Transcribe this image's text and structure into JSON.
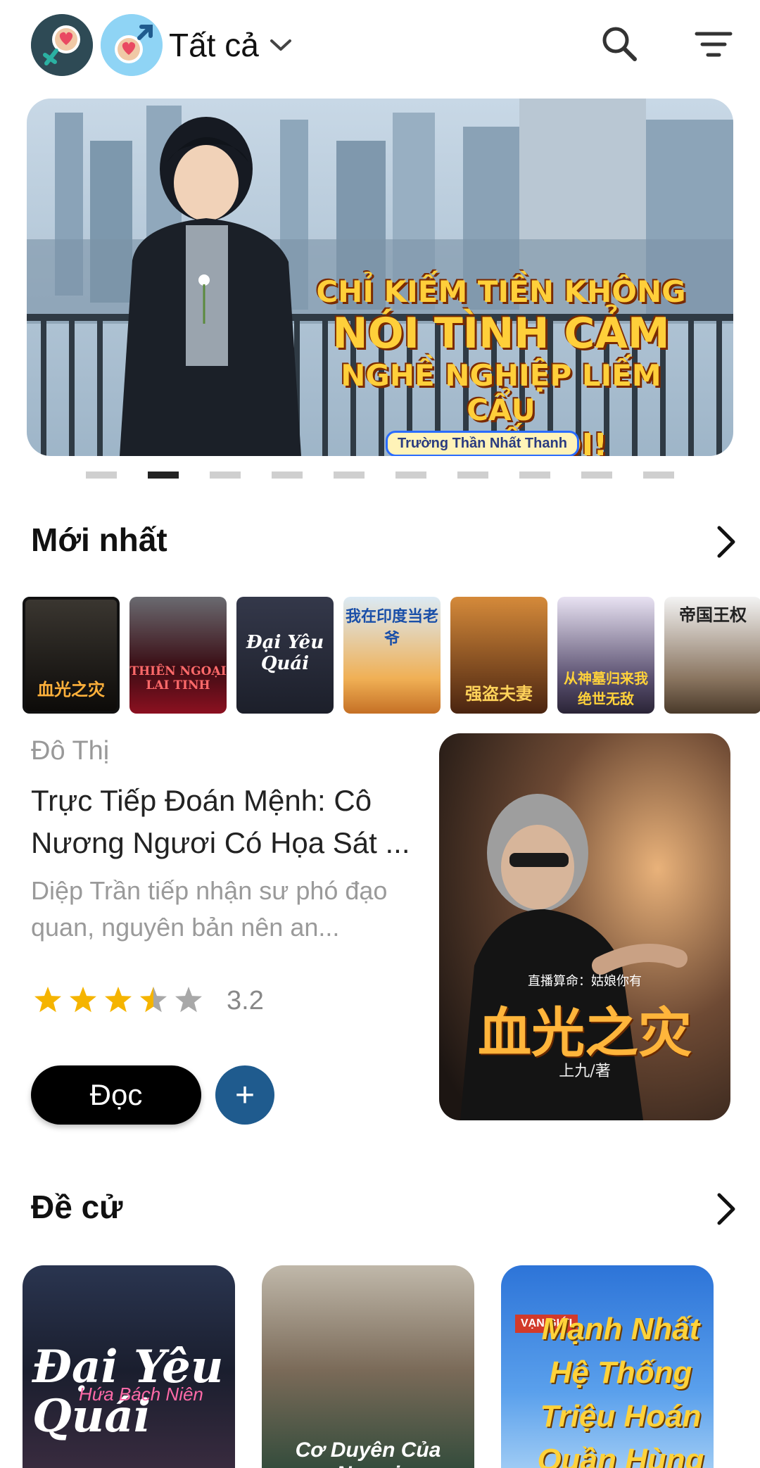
{
  "header": {
    "gender_filter": "Tất cả",
    "icons": [
      "heart-female-icon",
      "heart-male-icon",
      "chevron-down-icon",
      "search-icon",
      "filter-icon"
    ]
  },
  "banner": {
    "title_lines": [
      "CHỈ KIẾM TIỀN KHÔNG",
      "NÓI TÌNH CẢM",
      "NGHỀ NGHIỆP LIẾM CẨU",
      "TA NHẤT ĐI!"
    ],
    "author_tag": "Trường Thần Nhất Thanh",
    "page_count": 10,
    "active_index": 1
  },
  "newest": {
    "title": "Mới nhất",
    "thumbnails": [
      {
        "text": "血光之灾"
      },
      {
        "text": "THIÊN NGOẠI LAI TINH"
      },
      {
        "text": "Đại Yêu Quái"
      },
      {
        "text": "我在印度当老爷"
      },
      {
        "text": "强盗夫妻"
      },
      {
        "text": "从神墓归来我绝世无敌"
      },
      {
        "text": "帝国王权"
      }
    ],
    "featured": {
      "genre": "Đô Thị",
      "title": "Trực Tiếp Đoán Mệnh: Cô Nương Ngươi Có Họa Sát ...",
      "description": "Diệp Trần tiếp nhận sư phó đạo quan, nguyên bản nên an...",
      "rating": "3.2",
      "rating_value": 3.5,
      "read_label": "Đọc",
      "add_label": "+",
      "cover_subtitle": "直播算命：姑娘你有",
      "cover_title": "血光之灾",
      "cover_author": "上九/著"
    }
  },
  "recommended": {
    "title": "Đề cử",
    "items": [
      {
        "text": "Đại Yêu Quái",
        "sub": "Hứa Bách Niên"
      },
      {
        "text": "Cơ Duyên Của Ngươi"
      },
      {
        "text": "Mạnh Nhất Hệ Thống Triệu Hoán Quần Hùng",
        "badge": "VẠN GIỚI"
      }
    ]
  },
  "colors": {
    "accent_blue": "#1f5b8e",
    "star": "#f5b400",
    "star_empty": "#a8a8a8"
  }
}
